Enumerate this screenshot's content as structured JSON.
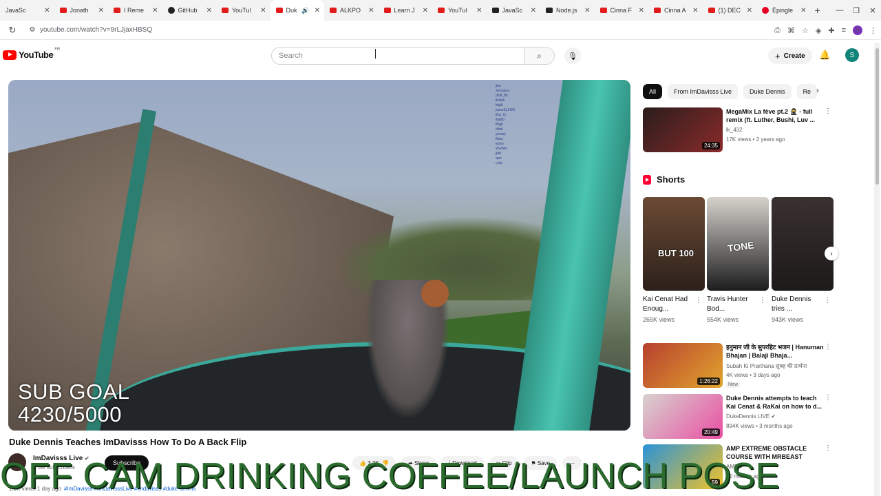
{
  "browser": {
    "tabs": [
      {
        "label": "JavaSc",
        "fav": "none"
      },
      {
        "label": "Jonath",
        "fav": "yt"
      },
      {
        "label": "I Reme",
        "fav": "yt"
      },
      {
        "label": "GitHub",
        "fav": "gh"
      },
      {
        "label": "YouTul",
        "fav": "yt"
      },
      {
        "label": "Duk",
        "fav": "yt",
        "active": true
      },
      {
        "label": "ALKPO",
        "fav": "yt"
      },
      {
        "label": "Learn J",
        "fav": "yt"
      },
      {
        "label": "YouTul",
        "fav": "yt"
      },
      {
        "label": "JavaSc",
        "fav": "nd"
      },
      {
        "label": "Node.js",
        "fav": "nd"
      },
      {
        "label": "Cinna F",
        "fav": "yt"
      },
      {
        "label": "Cinna A",
        "fav": "yt"
      },
      {
        "label": "(1) DEC",
        "fav": "yt"
      },
      {
        "label": "Épingle",
        "fav": "pin"
      }
    ],
    "url": "youtube.com/watch?v=9rLJjaxHBSQ"
  },
  "header": {
    "logo_text": "YouTube",
    "country_code": "FR",
    "search_placeholder": "Search",
    "create_label": "Create",
    "avatar_letter": "S"
  },
  "video": {
    "overlay_line1": "SUB GOAL",
    "overlay_line2": "4230/5000",
    "title": "Duke Dennis Teaches ImDavisss How To Do A Back Flip",
    "channel": "ImDavisss Live",
    "subscribers": "1.5M subscribers",
    "subscribe_label": "Subscribe",
    "likes": "3.2K",
    "share_label": "Share",
    "download_label": "Download",
    "clip_label": "Clip",
    "save_label": "Save",
    "views_time": "1.5K views  1 day ago",
    "tags": "#ImDavisss #ImDavisssLive #imdavisss #duke dennis",
    "chat_lines": [
      "jbm",
      "Xxmaxxx",
      "dkdf_ffn",
      "llkdvlk",
      "kbjdl",
      "jesse2p1421",
      "lilsy_t1",
      "lkjbbb",
      "ffbgh",
      "dlbdl",
      "ywnwy",
      "ffdsa",
      "kkmn",
      "WwWw",
      "jjdd",
      "qwz",
      "cyby"
    ]
  },
  "overlay_caption": "OFF CAM DRINKING COFFEE/LAUNCH POSE",
  "sidebar": {
    "chips": [
      "All",
      "From ImDavisss Live",
      "Duke Dennis",
      "Re"
    ],
    "recs": [
      {
        "title": "MegaMix La fève pt.2 🥷 - full remix (ft. Luther, Bushi, Luv ...",
        "channel": "lk_432",
        "meta": "17K views • 2 years ago",
        "duration": "24:35",
        "color1": "#2a1d1c",
        "color2": "#8a2a2a"
      },
      {
        "title": "हनुमान जी के सुपरहिट भजन | Hanuman Bhajan | Balaji Bhaja...",
        "channel": "Subah Ki Prarthana सुबह की प्रार्थना",
        "meta": "4K views • 3 days ago",
        "badge": "New",
        "duration": "1:26:22",
        "color1": "#b8402f",
        "color2": "#e0a52e"
      },
      {
        "title": "Duke Dennis attempts to teach Kai Cenat & RaKai on how to d...",
        "channel": "DukeDennis LIVE ✔",
        "meta": "894K views • 3 months ago",
        "duration": "20:49",
        "color1": "#d7d3ce",
        "color2": "#e94fa3"
      },
      {
        "title": "AMP EXTREME OBSTACLE COURSE WITH MRBEAST",
        "channel": "AMP ✔",
        "meta": "10 months ago",
        "duration": "59",
        "color1": "#2b93d8",
        "color2": "#f0c22a"
      }
    ],
    "shorts_title": "Shorts",
    "shorts": [
      {
        "title": "Kai Cenat Had Enoug...",
        "views": "265K views",
        "caption": "BUT 100",
        "color1": "#6b4a34",
        "color2": "#2c211b"
      },
      {
        "title": "Travis Hunter Bod...",
        "views": "554K views",
        "caption": "TONE",
        "color1": "#d6d3cc",
        "color2": "#1c1c1e"
      },
      {
        "title": "Duke Dennis tries ...",
        "views": "943K views",
        "caption": "",
        "color1": "#3a3030",
        "color2": "#1d1a1a"
      }
    ]
  }
}
